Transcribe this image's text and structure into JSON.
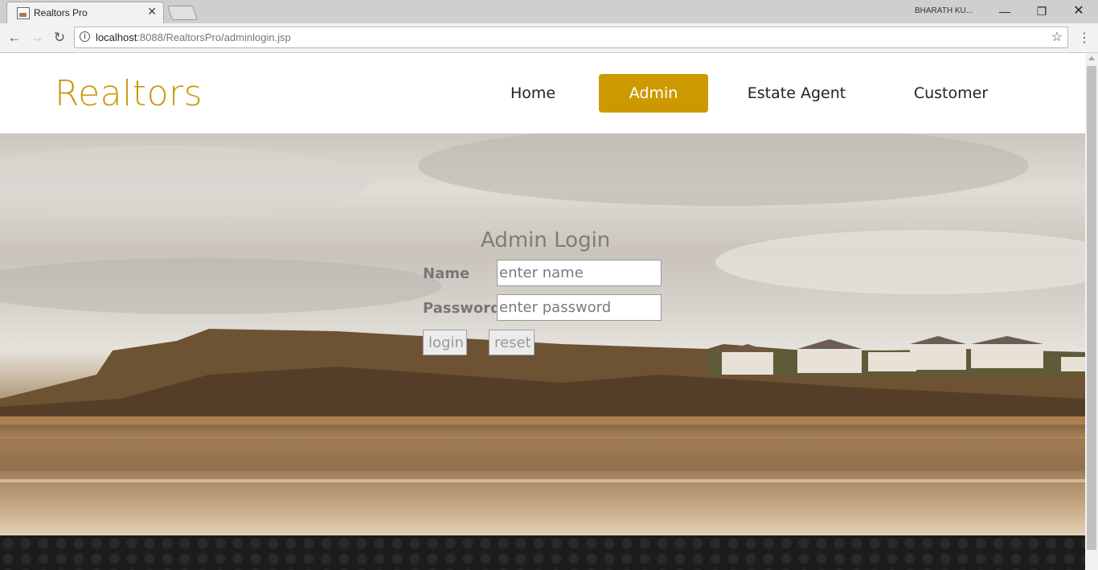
{
  "browser": {
    "tab_title": "Realtors Pro",
    "user_name": "BHARATH KU...",
    "url_host": "localhost",
    "url_path": ":8088/RealtorsPro/adminlogin.jsp"
  },
  "site": {
    "logo": "Realtors",
    "nav": {
      "home": "Home",
      "admin": "Admin",
      "estate_agent": "Estate Agent",
      "customer": "Customer"
    },
    "accent_color": "#cc9a00"
  },
  "login": {
    "title": "Admin Login",
    "name_label": "Name",
    "name_placeholder": "enter name",
    "password_label": "Password",
    "password_placeholder": "enter password",
    "login_button": "login",
    "reset_button": "reset"
  }
}
